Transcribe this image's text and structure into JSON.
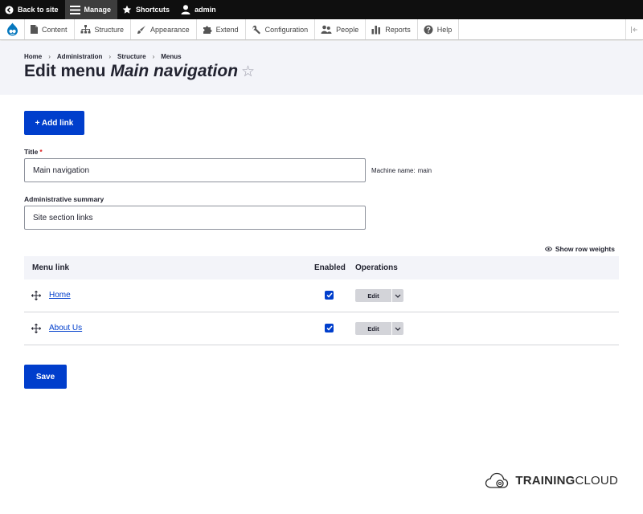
{
  "toolbar": {
    "back_label": "Back to site",
    "manage_label": "Manage",
    "shortcuts_label": "Shortcuts",
    "user_label": "admin"
  },
  "admin_menu": {
    "items": [
      {
        "label": "Content",
        "icon": "page-icon"
      },
      {
        "label": "Structure",
        "icon": "sitemap-icon"
      },
      {
        "label": "Appearance",
        "icon": "paintbrush-icon"
      },
      {
        "label": "Extend",
        "icon": "puzzle-icon"
      },
      {
        "label": "Configuration",
        "icon": "wrench-icon"
      },
      {
        "label": "People",
        "icon": "people-icon"
      },
      {
        "label": "Reports",
        "icon": "bar-chart-icon"
      },
      {
        "label": "Help",
        "icon": "help-icon"
      }
    ]
  },
  "breadcrumb": [
    "Home",
    "Administration",
    "Structure",
    "Menus"
  ],
  "page": {
    "title_prefix": "Edit menu",
    "title_name": "Main navigation"
  },
  "form": {
    "add_link_label": "+ Add link",
    "title_label": "Title",
    "title_value": "Main navigation",
    "machine_name_label": "Machine name:",
    "machine_name_value": "main",
    "summary_label": "Administrative summary",
    "summary_value": "Site section links",
    "row_weights_label": "Show row weights",
    "save_label": "Save"
  },
  "table": {
    "headers": {
      "menu_link": "Menu link",
      "enabled": "Enabled",
      "operations": "Operations"
    },
    "rows": [
      {
        "link": "Home",
        "enabled": true,
        "operation": "Edit"
      },
      {
        "link": "About Us",
        "enabled": true,
        "operation": "Edit"
      }
    ]
  },
  "brand": {
    "bold": "TRAINING",
    "regular": "CLOUD"
  },
  "colors": {
    "primary": "#003ecc",
    "toolbar": "#0f0f0f",
    "header_bg": "#f3f4f9"
  }
}
